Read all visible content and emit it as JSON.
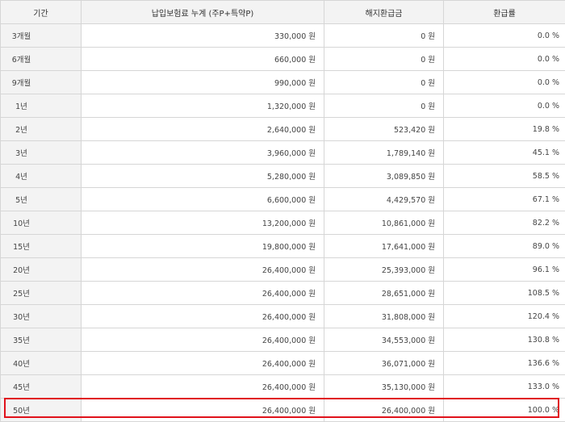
{
  "headers": {
    "period": "기간",
    "premium": "납입보험료 누계 (주P+특약P)",
    "surrender": "해지환급금",
    "rate": "환급률"
  },
  "rows": [
    {
      "period": "3개월",
      "premium": "330,000 원",
      "surrender": "0 원",
      "rate": "0.0 %"
    },
    {
      "period": "6개월",
      "premium": "660,000 원",
      "surrender": "0 원",
      "rate": "0.0 %"
    },
    {
      "period": "9개월",
      "premium": "990,000 원",
      "surrender": "0 원",
      "rate": "0.0 %"
    },
    {
      "period": "1년",
      "premium": "1,320,000 원",
      "surrender": "0 원",
      "rate": "0.0 %"
    },
    {
      "period": "2년",
      "premium": "2,640,000 원",
      "surrender": "523,420 원",
      "rate": "19.8 %"
    },
    {
      "period": "3년",
      "premium": "3,960,000 원",
      "surrender": "1,789,140 원",
      "rate": "45.1 %"
    },
    {
      "period": "4년",
      "premium": "5,280,000 원",
      "surrender": "3,089,850 원",
      "rate": "58.5 %"
    },
    {
      "period": "5년",
      "premium": "6,600,000 원",
      "surrender": "4,429,570 원",
      "rate": "67.1 %"
    },
    {
      "period": "10년",
      "premium": "13,200,000 원",
      "surrender": "10,861,000 원",
      "rate": "82.2 %"
    },
    {
      "period": "15년",
      "premium": "19,800,000 원",
      "surrender": "17,641,000 원",
      "rate": "89.0 %"
    },
    {
      "period": "20년",
      "premium": "26,400,000 원",
      "surrender": "25,393,000 원",
      "rate": "96.1 %"
    },
    {
      "period": "25년",
      "premium": "26,400,000 원",
      "surrender": "28,651,000 원",
      "rate": "108.5 %"
    },
    {
      "period": "30년",
      "premium": "26,400,000 원",
      "surrender": "31,808,000 원",
      "rate": "120.4 %"
    },
    {
      "period": "35년",
      "premium": "26,400,000 원",
      "surrender": "34,553,000 원",
      "rate": "130.8 %"
    },
    {
      "period": "40년",
      "premium": "26,400,000 원",
      "surrender": "36,071,000 원",
      "rate": "136.6 %"
    },
    {
      "period": "45년",
      "premium": "26,400,000 원",
      "surrender": "35,130,000 원",
      "rate": "133.0 %"
    },
    {
      "period": "50년",
      "premium": "26,400,000 원",
      "surrender": "26,400,000 원",
      "rate": "100.0 %"
    }
  ],
  "highlight": {
    "row_label": "50년",
    "color": "#e0121b"
  }
}
